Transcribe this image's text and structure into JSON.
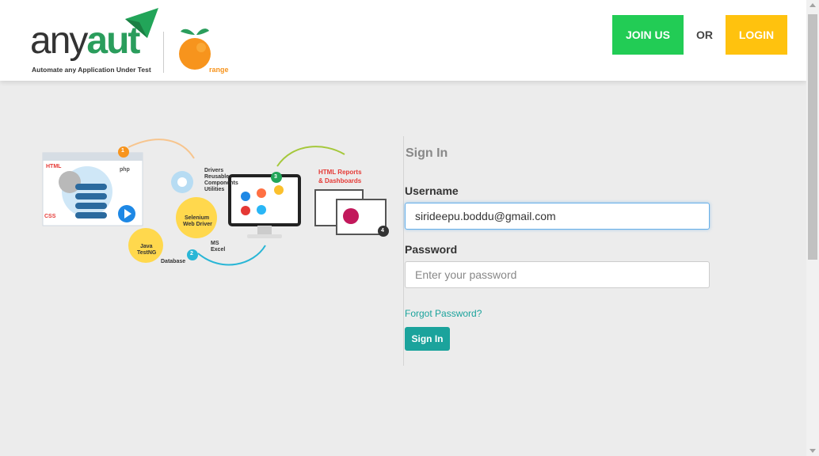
{
  "header": {
    "logo": {
      "word_main": "any",
      "word_accent": "aut",
      "tagline": "Automate any Application Under Test",
      "orange_text": "range"
    },
    "join_label": "JOIN US",
    "or_label": "OR",
    "login_label": "LOGIN",
    "colors": {
      "join": "#22cc55",
      "login": "#ffc20e",
      "accent": "#1ba39c"
    }
  },
  "illustration": {
    "steps": [
      "1",
      "2",
      "3",
      "4"
    ],
    "labels": {
      "html": "HTML",
      "css": "CSS",
      "php": "php",
      "drivers": "Drivers",
      "reusable": "Reusable",
      "components": "Components",
      "utilities": "Utilities",
      "selenium": "Selenium",
      "web_driver": "Web Driver",
      "java": "Java",
      "testng": "TestNG",
      "database": "Database",
      "ms": "MS",
      "excel": "Excel",
      "reports": "HTML Reports",
      "dashboards": "& Dashboards"
    }
  },
  "form": {
    "title": "Sign In",
    "username_label": "Username",
    "username_value": "sirideepu.boddu@gmail.com",
    "password_label": "Password",
    "password_placeholder": "Enter your password",
    "forgot_label": "Forgot Password?",
    "signin_label": "Sign In"
  }
}
